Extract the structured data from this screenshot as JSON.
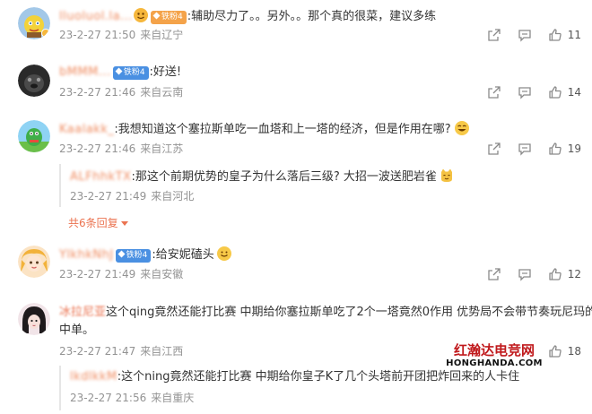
{
  "colors": {
    "accent": "#eb7350",
    "meta_grey": "#939393",
    "badge_blue": "#4a90e2",
    "watermark_red": "#c0191c"
  },
  "comments": [
    {
      "username": "lluoluol.la...",
      "badge": "铁粉4",
      "text": ":辅助尽力了。。另外。。那个真的很菜，建议多练",
      "time": "23-2-27 21:50",
      "location": "来自辽宁",
      "likes": "11"
    },
    {
      "username": "bMMM...",
      "badge": "铁粉4",
      "text": ":好送!",
      "time": "23-2-27 21:46",
      "location": "来自云南",
      "likes": "14"
    },
    {
      "username": "Kaalakk_",
      "text": ":我想知道这个塞拉斯单吃一血塔和上一塔的经济，但是作用在哪?",
      "time": "23-2-27 21:46",
      "location": "来自江苏",
      "likes": "19",
      "reply": {
        "username": "ALFhhkTX",
        "text": ":那这个前期优势的皇子为什么落后三级? 大招一波送肥岩雀",
        "time": "23-2-27 21:49",
        "location": "来自河北"
      },
      "more_replies": "共6条回复"
    },
    {
      "username": "YlkhkNhJ",
      "badge": "铁粉4",
      "text": ":给安妮磕头",
      "time": "23-2-27 21:49",
      "location": "来自安徽",
      "likes": "12"
    },
    {
      "username": "冰拉尼亚",
      "text": "这个qing竟然还能打比赛 中期给你塞拉斯单吃了2个一塔竟然0作用 优势局不会带节奏玩尼玛的",
      "text2": "中单。",
      "time": "23-2-27 21:47",
      "location": "来自江西",
      "likes": "18",
      "reply": {
        "username": "lkdlkkM",
        "text": ":这个ning竟然还能打比赛 中期给你皇子K了几个头塔前开团把炸回来的人卡住",
        "time": "23-2-27 21:56",
        "location": "来自重庆"
      }
    }
  ],
  "watermark": {
    "cn": "红瀚达电竞网",
    "en": "HONGHANDA.COM"
  }
}
